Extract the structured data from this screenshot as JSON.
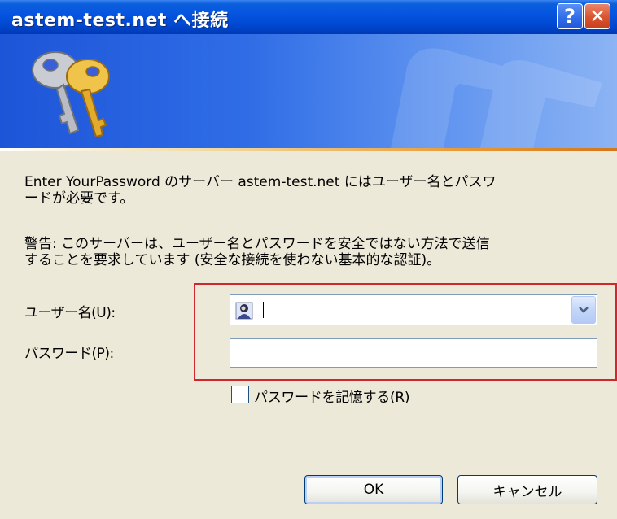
{
  "window": {
    "title": "astem-test.net へ接続",
    "help_label": "?",
    "close_label": "✕"
  },
  "messages": {
    "server_line1": "Enter YourPassword のサーバー astem-test.net にはユーザー名とパスワ",
    "server_line2": "ードが必要です。",
    "warning_line1": "警告: このサーバーは、ユーザー名とパスワードを安全ではない方法で送信",
    "warning_line2": "することを要求しています (安全な接続を使わない基本的な認証)。"
  },
  "form": {
    "username_label": "ユーザー名(U):",
    "username_value": "",
    "password_label": "パスワード(P):",
    "password_value": "",
    "remember_label": "パスワードを記憶する(R)",
    "remember_checked": false
  },
  "buttons": {
    "ok": "OK",
    "cancel": "キャンセル"
  },
  "icons": {
    "banner": "keys-icon",
    "user": "user-avatar-icon",
    "dropdown": "chevron-down-icon"
  },
  "colors": {
    "titlebar": "#0655e0",
    "dialog_bg": "#ece9d8",
    "highlight": "#d0262e",
    "close_button": "#d9532e"
  }
}
